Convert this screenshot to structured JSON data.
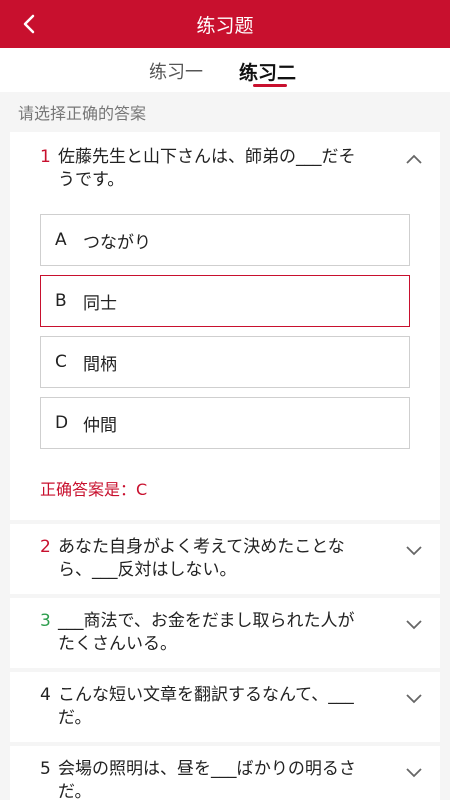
{
  "header": {
    "title": "练习题",
    "back_icon": "chevron-left-icon"
  },
  "tabs": [
    {
      "label": "练习一",
      "active": false
    },
    {
      "label": "练习二",
      "active": true
    }
  ],
  "hint": "请选择正确的答案",
  "questions": [
    {
      "num": "1",
      "num_color": "#c8102e",
      "line1": "佐藤先生と山下さんは、師弟の___だそ",
      "line2": "うです。",
      "expanded": true,
      "options": [
        {
          "letter": "A",
          "text": "つながり",
          "selected": false
        },
        {
          "letter": "B",
          "text": "同士",
          "selected": true
        },
        {
          "letter": "C",
          "text": "間柄",
          "selected": false
        },
        {
          "letter": "D",
          "text": "仲間",
          "selected": false
        }
      ],
      "answer": "正确答案是：C"
    },
    {
      "num": "2",
      "num_color": "#c8102e",
      "line1": "あなた自身がよく考えて決めたことな",
      "line2": "ら、___反対はしない。",
      "expanded": false
    },
    {
      "num": "3",
      "num_color": "#2e9e4e",
      "line1": "___商法で、お金をだまし取られた人が",
      "line2": "たくさんいる。",
      "expanded": false
    },
    {
      "num": "4",
      "num_color": "#222222",
      "line1": "こんな短い文章を翻訳するなんて、___",
      "line2": "だ。",
      "expanded": false
    },
    {
      "num": "5",
      "num_color": "#222222",
      "line1": "会場の照明は、昼を___ばかりの明るさ",
      "line2": "だ。",
      "expanded": false
    }
  ],
  "colors": {
    "accent": "#c8102e",
    "correct": "#2e9e4e"
  }
}
